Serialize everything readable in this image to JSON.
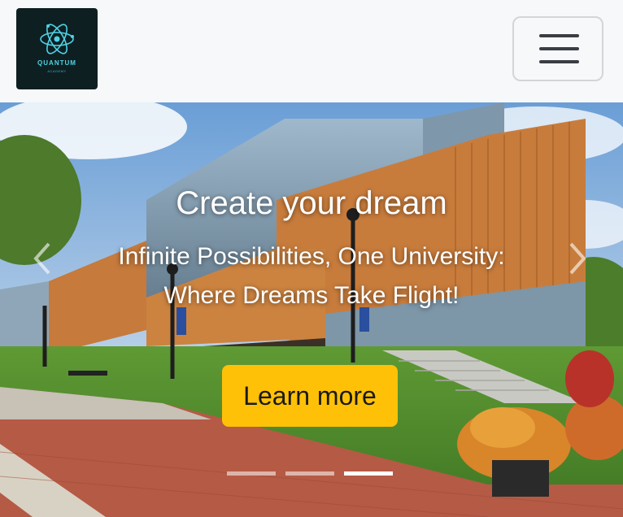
{
  "brand": {
    "name": "QUANTUM",
    "tagline": "ACADEMY",
    "logo_icon": "atom-icon",
    "accent_color": "#4fd3e6",
    "background_color": "#0e1f22"
  },
  "navbar": {
    "toggler_icon": "hamburger-icon"
  },
  "hero": {
    "title": "Create your dream",
    "subtitle_line1": "Infinite Possibilities, One University:",
    "subtitle_line2": "Where Dreams Take Flight!",
    "cta_label": "Learn more",
    "cta_color": "#ffc107",
    "prev_icon": "chevron-left-icon",
    "next_icon": "chevron-right-icon",
    "slide_count": 3,
    "active_slide": 3
  }
}
